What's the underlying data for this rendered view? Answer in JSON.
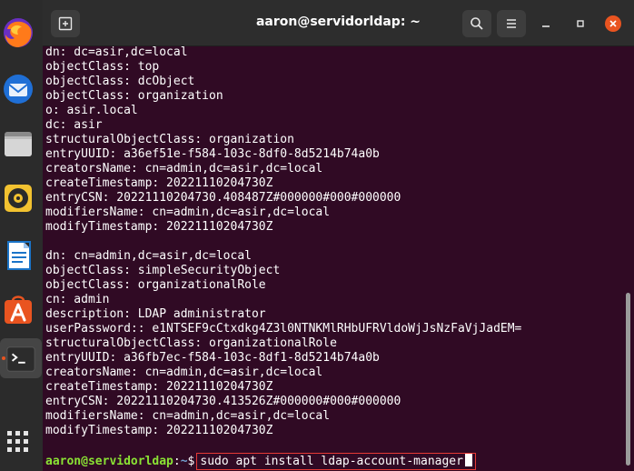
{
  "window": {
    "title": "aaron@servidorldap: ~"
  },
  "dock": {
    "items": [
      {
        "icon": "firefox-icon"
      },
      {
        "icon": "thunderbird-icon"
      },
      {
        "icon": "files-icon"
      },
      {
        "icon": "rhythmbox-icon"
      },
      {
        "icon": "libreoffice-writer-icon"
      },
      {
        "icon": "ubuntu-software-icon"
      },
      {
        "icon": "terminal-icon"
      },
      {
        "icon": "show-applications-icon"
      }
    ]
  },
  "terminal": {
    "lines": [
      "dn: dc=asir,dc=local",
      "objectClass: top",
      "objectClass: dcObject",
      "objectClass: organization",
      "o: asir.local",
      "dc: asir",
      "structuralObjectClass: organization",
      "entryUUID: a36ef51e-f584-103c-8df0-8d5214b74a0b",
      "creatorsName: cn=admin,dc=asir,dc=local",
      "createTimestamp: 20221110204730Z",
      "entryCSN: 20221110204730.408487Z#000000#000#000000",
      "modifiersName: cn=admin,dc=asir,dc=local",
      "modifyTimestamp: 20221110204730Z",
      "",
      "dn: cn=admin,dc=asir,dc=local",
      "objectClass: simpleSecurityObject",
      "objectClass: organizationalRole",
      "cn: admin",
      "description: LDAP administrator",
      "userPassword:: e1NTSEF9cCtxdkg4Z3l0NTNKMlRHbUFRVldoWjJsNzFaVjJadEM=",
      "structuralObjectClass: organizationalRole",
      "entryUUID: a36fb7ec-f584-103c-8df1-8d5214b74a0b",
      "creatorsName: cn=admin,dc=asir,dc=local",
      "createTimestamp: 20221110204730Z",
      "entryCSN: 20221110204730.413526Z#000000#000#000000",
      "modifiersName: cn=admin,dc=asir,dc=local",
      "modifyTimestamp: 20221110204730Z",
      ""
    ],
    "prompt": {
      "user_host": "aaron@servidorldap",
      "separator": ":",
      "path": "~",
      "symbol": "$",
      "command": "sudo apt install ldap-account-manager"
    }
  },
  "colors": {
    "terminal_bg": "#300a24",
    "prompt_user": "#8ae234",
    "prompt_path": "#729fcf",
    "highlight_border": "#e53935",
    "ubuntu_orange": "#e95420"
  }
}
